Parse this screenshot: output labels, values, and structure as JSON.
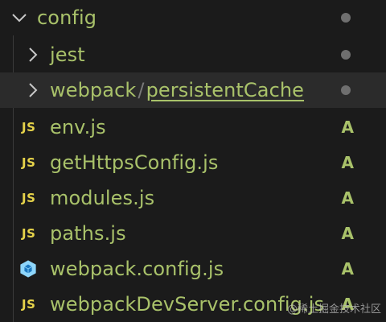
{
  "explorer": {
    "root_folder": {
      "label": "config",
      "status_dot": true
    },
    "folders": [
      {
        "label": "jest",
        "status_dot": true
      },
      {
        "label_prefix": "webpack",
        "separator": "/",
        "label_suffix": "persistentCache",
        "status_dot": true
      }
    ],
    "files": [
      {
        "label": "env.js",
        "icon": "javascript-icon",
        "icon_text": "JS",
        "status": "A"
      },
      {
        "label": "getHttpsConfig.js",
        "icon": "javascript-icon",
        "icon_text": "JS",
        "status": "A"
      },
      {
        "label": "modules.js",
        "icon": "javascript-icon",
        "icon_text": "JS",
        "status": "A"
      },
      {
        "label": "paths.js",
        "icon": "javascript-icon",
        "icon_text": "JS",
        "status": "A"
      },
      {
        "label": "webpack.config.js",
        "icon": "webpack-icon",
        "status": "A"
      },
      {
        "label": "webpackDevServer.config.js",
        "icon": "javascript-icon",
        "icon_text": "JS",
        "status": "A"
      }
    ]
  },
  "watermark": "@稀土掘金技术社区",
  "colors": {
    "background": "#1b1b1b",
    "hover_row": "#2b2b2b",
    "added_green": "#a9c26a",
    "js_yellow": "#e6d34a",
    "dot_gray": "#6f6f6f",
    "webpack_blue": "#8ed6fb"
  }
}
